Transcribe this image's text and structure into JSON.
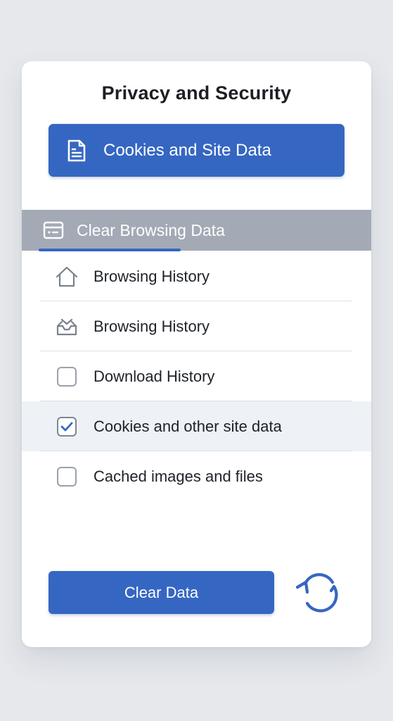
{
  "panel": {
    "title": "Privacy and Security"
  },
  "primary_section": {
    "label": "Cookies and Site Data",
    "icon": "document-icon"
  },
  "active_tab": {
    "label": "Clear Browsing Data",
    "icon": "browser-window-icon"
  },
  "items": [
    {
      "label": "Browsing History",
      "icon": "home-icon",
      "checked": null
    },
    {
      "label": "Browsing History",
      "icon": "inbox-tray-icon",
      "checked": null
    },
    {
      "label": "Download History",
      "icon": "checkbox",
      "checked": false
    },
    {
      "label": "Cookies and other site data",
      "icon": "checkbox",
      "checked": true
    },
    {
      "label": "Cached images and files",
      "icon": "checkbox",
      "checked": false
    }
  ],
  "actions": {
    "clear_label": "Clear Data",
    "refresh_icon": "refresh-icon"
  },
  "colors": {
    "accent": "#3567c2",
    "tab_bar": "#a3aab5",
    "background": "#e6e8ec",
    "card": "#ffffff",
    "selected_row": "#eef1f5"
  }
}
